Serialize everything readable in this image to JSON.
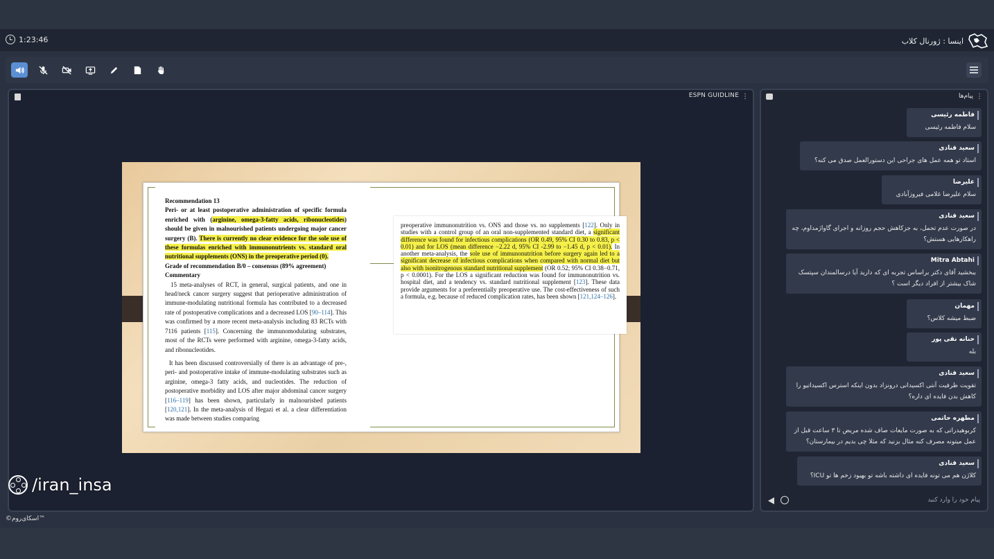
{
  "session": {
    "timer": "1:23:46",
    "app_title": "اینسا : ژورنال کلاب"
  },
  "toolbar": {
    "buttons": [
      {
        "name": "speaker",
        "active": true
      },
      {
        "name": "mic",
        "active": false
      },
      {
        "name": "camera",
        "active": false
      },
      {
        "name": "share-screen",
        "active": false
      },
      {
        "name": "pen",
        "active": false
      },
      {
        "name": "document",
        "active": false
      },
      {
        "name": "raise-hand",
        "active": false
      }
    ],
    "active_color": "#5b8fd4"
  },
  "presentation": {
    "title": "ESPN GUIDLINE",
    "left_page": {
      "heading": "Recommendation 13",
      "p1_a": "Peri- or at least postoperative administration of specific formula enriched with (",
      "p1_hl1": "arginine, omega-3-fatty acids, ribonucleotides",
      "p1_b": ") should be given in malnourished patients undergoing major cancer surgery (B). ",
      "p1_hl2": "There is currently no clear evidence for the sole use of these formulas enriched with immunonutrients vs. standard oral nutritional supplements (ONS) in the preoperative period (0).",
      "grade": "Grade of recommendation B/0 – consensus (89% agreement)",
      "commentary": "Commentary",
      "p2_a": "15 meta-analyses of RCT, in general, surgical patients, and one in head/neck cancer surgery suggest that perioperative administration of immune-modulating nutritional formula has contributed to a decreased rate of postoperative complications and a decreased LOS [",
      "p2_ref1": "90–114",
      "p2_b": "]. This was confirmed by a more recent meta-analysis including 83 RCTs with 7116 patients [",
      "p2_ref2": "115",
      "p2_c": "]. Concerning the immunomodulating substrates, most of the RCTs were performed with arginine, omega-3-fatty acids, and ribonucleotides.",
      "p3_a": "It has been discussed controversially of there is an advantage of pre-, peri- and postoperative intake of immune-modulating substrates such as arginine, omega-3 fatty acids, and nucleotides. The reduction of postoperative morbidity and LOS after major abdominal cancer surgery [",
      "p3_ref1": "116–119",
      "p3_b": "] has been shown, particularly in malnourished patients [",
      "p3_ref2": "120,121",
      "p3_c": "]. In the meta-analysis of Hegazi et al. a clear differentiation was made between studies comparing"
    },
    "right_page": {
      "a": "preoperative immunonutrition vs. ONS and those vs. no supplements [",
      "ref1": "122",
      "b": "]. Only in studies with a control group of an oral non-supplemented standard diet, a ",
      "hl1": "significant difference was found for infectious complications (OR 0.49, 95% CI 0.30 to 0.83, p < 0.01) and for LOS (mean difference −2.22 d, 95% CI -2.99 to −1.45 d, p < 0.01).",
      "c": " In another meta-analysis, the ",
      "hl2": "sole use of immunonutrition before surgery again led to a significant decrease of infectious complications when compared with normal diet but also with isonitrogenous standard nutritional supplement",
      "d": " (OR 0.52; 95% CI 0.38−0.71, p < 0.0001). For the LOS a significant reduction was found for immunonutrition vs. hospital diet, and a tendency vs. standard nutritional supplement [",
      "ref2": "123",
      "e": "]. These data provide arguments for a preferentially preoperative use. The cost-effectiveness of such a formula, e.g. because of reduced complication rates, has been shown [",
      "ref3": "121,124–126",
      "f": "]."
    }
  },
  "watermark": "/iran_insa",
  "footer": "©اسکای‌روم™",
  "chat": {
    "title": "پیام‌ها",
    "input_placeholder": "پیام خود را وارد کنید",
    "messages": [
      {
        "name": "فاطمه رئیسی",
        "text": "سلام فاطمه رئیسی"
      },
      {
        "name": "سعید قنادی",
        "text": "استاد تو همه عمل های جراحی این دستورالعمل صدق می کنه؟"
      },
      {
        "name": "علیرضا",
        "text": "سلام علیرضا غلامی فیروزآبادی"
      },
      {
        "name": "سعید قنادی",
        "text": "در صورت عدم تحمل، به جزکاهش حجم روزانه و اجرای گاواژمداوم، چه راهکارهایی هستش؟"
      },
      {
        "name": "Mitra Abtahi",
        "text": "ببخشید آقای دکتر  براساس تجربه ای که دارید آیا درسالمندان سپتسک شاک بیشتر از افراد دیگر است ؟"
      },
      {
        "name": "مهمان",
        "text": "ضبط میشه کلاس؟"
      },
      {
        "name": "حنانه نقی پور",
        "text": "بله"
      },
      {
        "name": "سعید قنادی",
        "text": "تقویت ظرفیت آنتی اکسیدانی درونزاد بدون اینکه استرس اکسیداتیو را کاهش بدن فایده ای داره؟"
      },
      {
        "name": "مطهره حاتمی",
        "text": "کربوهیدراتی که به صورت مایعات صاف شده مریض تا ۳ ساعت قبل از عمل میتونه مصرف کنه مثال بزنید که مثلا چی بدیم در بیمارستان؟"
      },
      {
        "name": "سعید قنادی",
        "text": "کلاژن هم می تونه فایده ای داشته باشه تو بهبود زخم ها تو ICU؟"
      }
    ]
  }
}
